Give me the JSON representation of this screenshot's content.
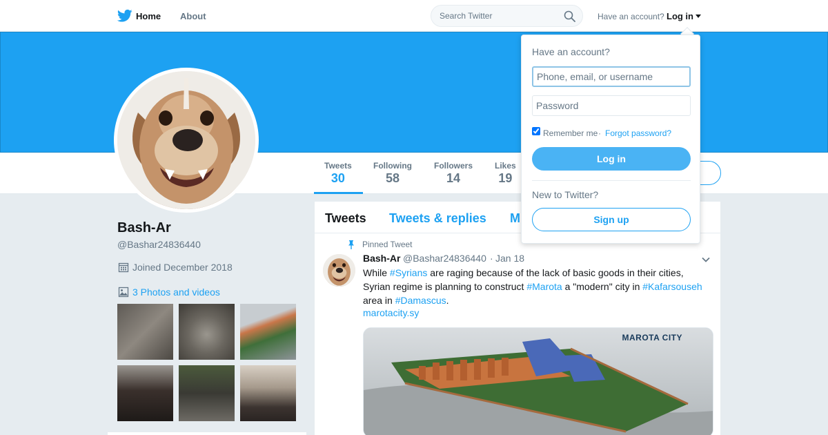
{
  "nav": {
    "home": "Home",
    "about": "About",
    "search_placeholder": "Search Twitter",
    "have_account": "Have an account?",
    "login": "Log in"
  },
  "stats": [
    {
      "label": "Tweets",
      "value": "30"
    },
    {
      "label": "Following",
      "value": "58"
    },
    {
      "label": "Followers",
      "value": "14"
    },
    {
      "label": "Likes",
      "value": "19"
    }
  ],
  "profile": {
    "name": "Bash-Ar",
    "handle": "@Bashar24836440",
    "joined": "Joined December 2018",
    "photos_link": "3 Photos and videos"
  },
  "timeline": {
    "tabs": [
      "Tweets",
      "Tweets & replies",
      "M"
    ],
    "pinned_label": "Pinned Tweet",
    "tweet": {
      "name": "Bash-Ar",
      "handle": "@Bashar24836440",
      "separator": "·",
      "date": "Jan 18",
      "text_1": "While ",
      "tag_1": "#Syrians",
      "text_2": " are raging because of the lack of basic goods in their cities, Syrian regime is planning to construct ",
      "tag_2": "#Marota",
      "text_3": " a \"modern\" city in ",
      "tag_3": "#Kafarsouseh",
      "text_4": " area in ",
      "tag_4": "#Damascus",
      "text_5": ".",
      "url": "marotacity.sy",
      "media_logo": "MAROTA CITY"
    }
  },
  "login_dropdown": {
    "title": "Have an account?",
    "username_placeholder": "Phone, email, or username",
    "password_placeholder": "Password",
    "remember": "Remember me",
    "separator": "·",
    "forgot": "Forgot password?",
    "login_button": "Log in",
    "new_to": "New to Twitter?",
    "signup_button": "Sign up"
  },
  "colors": {
    "brand": "#1da1f2",
    "banner": "#1da1f2",
    "login_button": "#4ab3f4"
  }
}
